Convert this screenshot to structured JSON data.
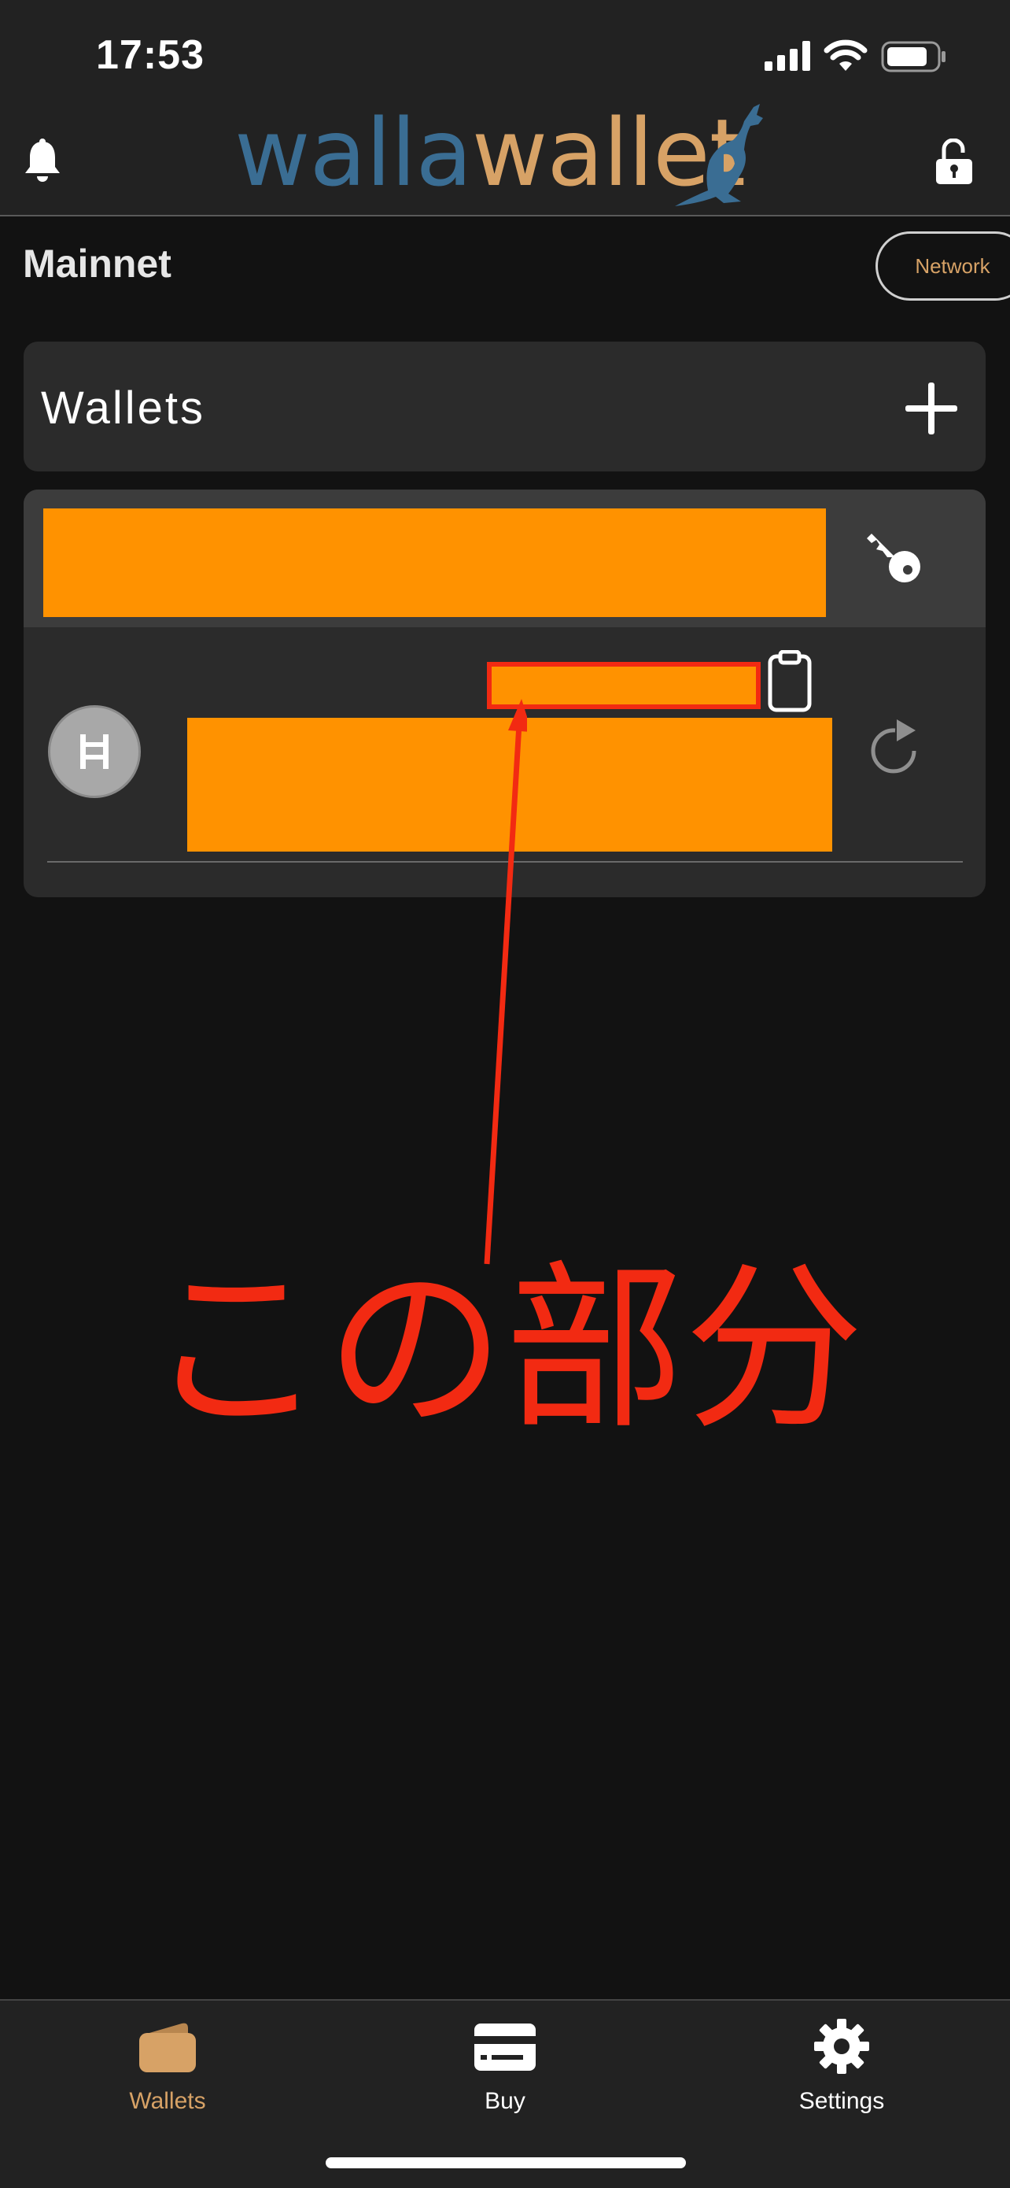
{
  "status_bar": {
    "time": "17:53"
  },
  "header": {
    "logo_part1": "walla",
    "logo_part2": "wallet",
    "bell_icon": "bell-icon",
    "lock_icon": "unlocked-padlock-icon"
  },
  "network": {
    "name": "Mainnet",
    "button_label": "Network"
  },
  "wallets": {
    "title": "Wallets",
    "add_icon": "plus-icon"
  },
  "wallet_item": {
    "key_icon": "key-icon",
    "copy_icon": "clipboard-icon",
    "refresh_icon": "refresh-icon",
    "token_icon": "hbar-icon"
  },
  "annotation": {
    "text": "この部分"
  },
  "tabs": [
    {
      "label": "Wallets",
      "icon": "wallet-icon",
      "active": true
    },
    {
      "label": "Buy",
      "icon": "card-icon",
      "active": false
    },
    {
      "label": "Settings",
      "icon": "gear-icon",
      "active": false
    }
  ],
  "colors": {
    "accent": "#d7a266",
    "logo_blue": "#3a6d93",
    "redaction": "#ff9200",
    "annotation_red": "#f22a12",
    "background": "#121212",
    "card": "#2b2b2b"
  }
}
